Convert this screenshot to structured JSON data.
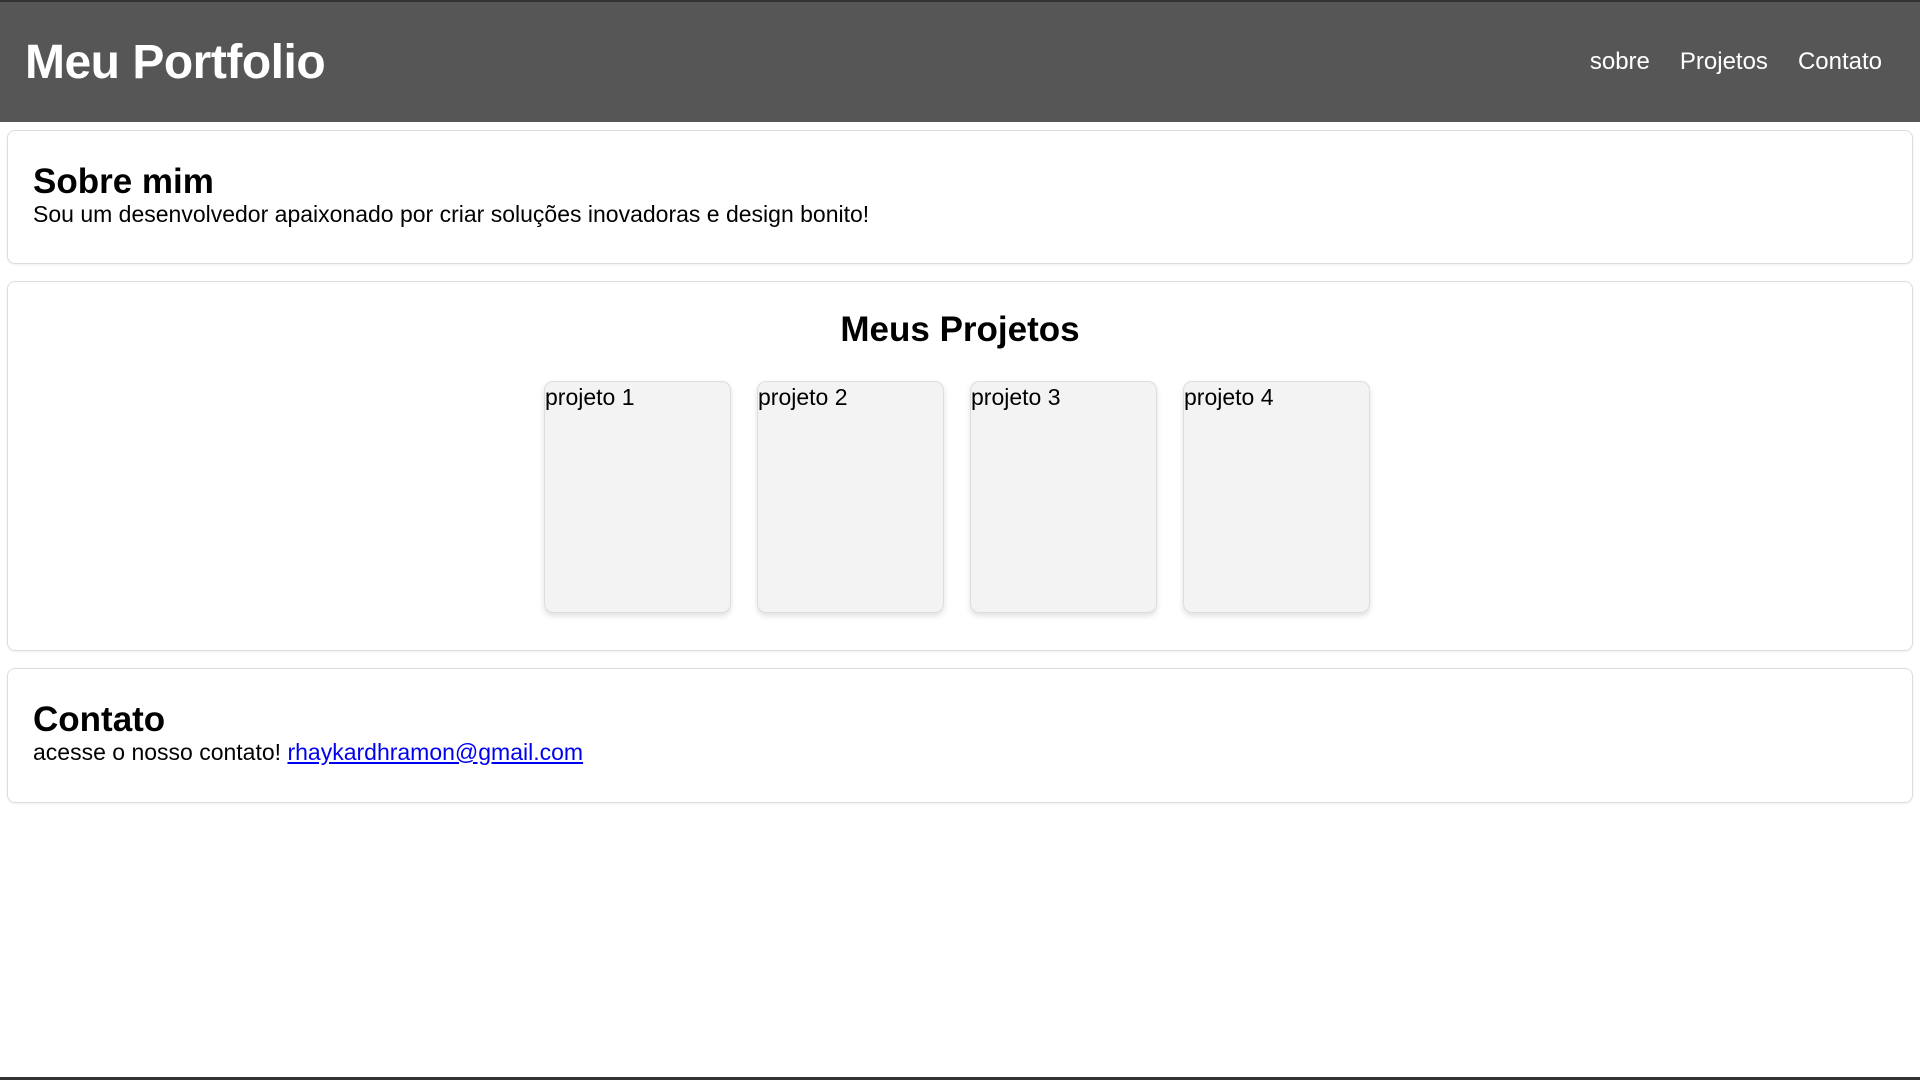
{
  "header": {
    "title": "Meu Portfolio",
    "nav": [
      "sobre",
      "Projetos",
      "Contato"
    ]
  },
  "about": {
    "heading": "Sobre mim",
    "text": "Sou um desenvolvedor apaixonado por criar soluções inovadoras e design bonito!"
  },
  "projects": {
    "heading": "Meus Projetos",
    "items": [
      "projeto 1",
      "projeto 2",
      "projeto 3",
      "projeto 4"
    ]
  },
  "contact": {
    "heading": "Contato",
    "text": "acesse o nosso contato!",
    "email": "rhaykardhramon@gmail.com"
  },
  "colors": {
    "header_bg": "#565656",
    "card_bg": "#f3f3f3",
    "link": "#0000ee"
  }
}
